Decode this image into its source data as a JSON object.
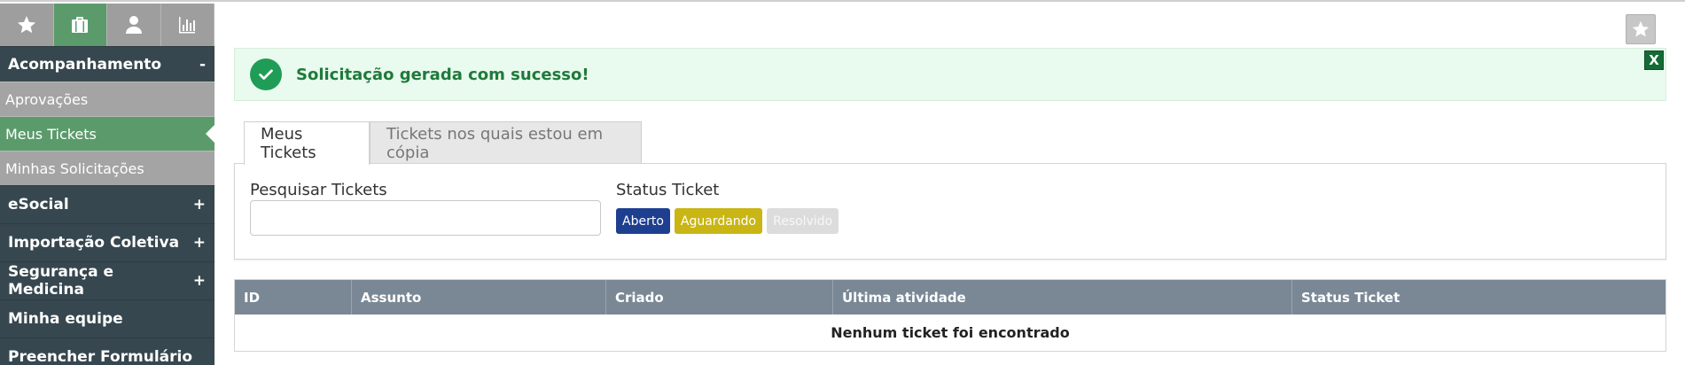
{
  "sidebar": {
    "icon_tabs": [
      {
        "icon": "star-icon",
        "active": false
      },
      {
        "icon": "briefcase-icon",
        "active": true
      },
      {
        "icon": "user-icon",
        "active": false
      },
      {
        "icon": "bar-chart-icon",
        "active": false
      }
    ],
    "sections": [
      {
        "label": "Acompanhamento",
        "sign": "-"
      },
      {
        "label": "eSocial",
        "sign": "+"
      },
      {
        "label": "Importação Coletiva",
        "sign": "+"
      },
      {
        "label": "Segurança e Medicina",
        "sign": "+"
      },
      {
        "label": "Minha equipe",
        "sign": ""
      },
      {
        "label": "Preencher Formulário",
        "sign": ""
      }
    ],
    "sub_items": [
      {
        "label": "Aprovações"
      },
      {
        "label": "Meus Tickets"
      },
      {
        "label": "Minhas Solicitações"
      }
    ]
  },
  "favorite_icon": "star-icon",
  "alert": {
    "message": "Solicitação gerada com sucesso!",
    "close_label": "X",
    "color": "#1f9d57"
  },
  "tabs": [
    {
      "label": "Meus Tickets"
    },
    {
      "label": "Tickets nos quais estou em cópia"
    }
  ],
  "filters": {
    "search_label": "Pesquisar Tickets",
    "search_value": "",
    "status_label": "Status Ticket",
    "statuses": [
      {
        "label": "Aberto",
        "color": "#1e3f8f"
      },
      {
        "label": "Aguardando",
        "color": "#c9b615"
      },
      {
        "label": "Resolvido",
        "color": "#dcdcdc"
      }
    ]
  },
  "table": {
    "headers": [
      "ID",
      "Assunto",
      "Criado",
      "Última atividade",
      "Status Ticket"
    ],
    "empty_message": "Nenhum ticket foi encontrado"
  }
}
